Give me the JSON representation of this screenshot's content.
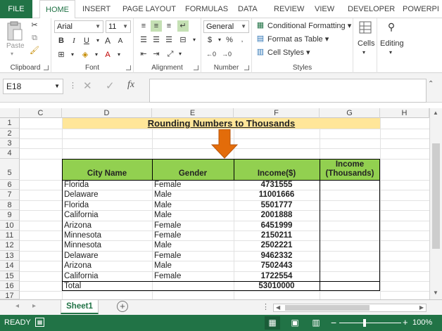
{
  "ribbon_tabs": [
    "FILE",
    "HOME",
    "INSERT",
    "PAGE LAYOUT",
    "FORMULAS",
    "DATA",
    "REVIEW",
    "VIEW",
    "DEVELOPER",
    "POWERPI"
  ],
  "active_tab": "HOME",
  "clipboard": {
    "paste_label": "Paste",
    "group_label": "Clipboard"
  },
  "font": {
    "family": "Arial",
    "size": "11",
    "group_label": "Font"
  },
  "alignment": {
    "group_label": "Alignment"
  },
  "number": {
    "format": "General",
    "group_label": "Number",
    "currency": "$",
    "percent": "%"
  },
  "styles": {
    "conditional": "Conditional Formatting",
    "table": "Format as Table",
    "cell_styles": "Cell Styles",
    "group_label": "Styles"
  },
  "cells_group": {
    "label": "Cells"
  },
  "editing_group": {
    "label": "Editing"
  },
  "formula_bar": {
    "name_box": "E18",
    "fx": "fx",
    "value": ""
  },
  "columns": [
    "C",
    "D",
    "E",
    "F",
    "G",
    "H"
  ],
  "rows": [
    "1",
    "2",
    "3",
    "4",
    "5",
    "6",
    "7",
    "8",
    "9",
    "10",
    "11",
    "12",
    "13",
    "14",
    "15",
    "16",
    "17"
  ],
  "sheet": {
    "title": "Rounding Numbers to Thousands",
    "headers": {
      "city": "City Name",
      "gender": "Gender",
      "income": "Income($)",
      "income_k_1": "Income",
      "income_k_2": "(Thousands)"
    },
    "data": [
      [
        "Florida",
        "Female",
        "4731555"
      ],
      [
        "Delaware",
        "Male",
        "11001666"
      ],
      [
        "Florida",
        "Male",
        "5501777"
      ],
      [
        "California",
        "Male",
        "2001888"
      ],
      [
        "Arizona",
        "Female",
        "6451999"
      ],
      [
        "Minnesota",
        "Female",
        "2150211"
      ],
      [
        "Minnesota",
        "Male",
        "2502221"
      ],
      [
        "Delaware",
        "Female",
        "9462332"
      ],
      [
        "Arizona",
        "Male",
        "7502443"
      ],
      [
        "California",
        "Female",
        "1722554"
      ]
    ],
    "total_label": "Total",
    "total_value": "53010000"
  },
  "sheet_tabs": [
    "Sheet1"
  ],
  "status": {
    "ready": "READY",
    "zoom": "100%"
  },
  "colors": {
    "excel_green": "#217346",
    "header_green": "#92d050",
    "title_yellow": "#ffe699",
    "arrow": "#e36c0a"
  }
}
